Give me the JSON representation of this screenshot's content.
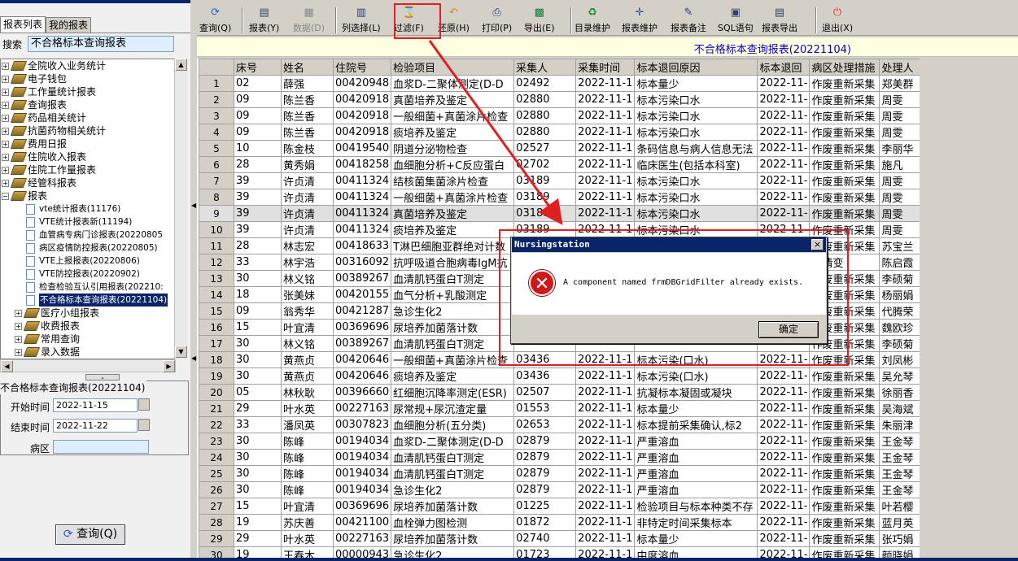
{
  "left": {
    "tabs": [
      "报表列表",
      "我的报表"
    ],
    "search_label": "搜索",
    "search_value": "不合格标本查询报表",
    "tree": [
      {
        "label": "全院收入业务统计",
        "type": "folder"
      },
      {
        "label": "电子钱包",
        "type": "folder"
      },
      {
        "label": "工作量统计报表",
        "type": "folder"
      },
      {
        "label": "查询报表",
        "type": "folder"
      },
      {
        "label": "药品相关统计",
        "type": "folder"
      },
      {
        "label": "抗菌药物相关统计",
        "type": "folder"
      },
      {
        "label": "费用日报",
        "type": "folder"
      },
      {
        "label": "住院收入报表",
        "type": "folder"
      },
      {
        "label": "住院工作量报表",
        "type": "folder"
      },
      {
        "label": "经管科报表",
        "type": "folder"
      },
      {
        "label": "报表",
        "type": "folder-open"
      },
      {
        "label": "vte统计报表(11176)",
        "type": "doc"
      },
      {
        "label": "VTE统计报表新(11194)",
        "type": "doc"
      },
      {
        "label": "血管病专病门诊报表(20220805",
        "type": "doc"
      },
      {
        "label": "病区疫情防控报表(20220805)",
        "type": "doc"
      },
      {
        "label": "VTE上报报表(20220806)",
        "type": "doc"
      },
      {
        "label": "VTE防控报表(20220902)",
        "type": "doc"
      },
      {
        "label": "检查检验互认引用报表(202210:",
        "type": "doc"
      },
      {
        "label": "不合格标本查询报表(20221104)",
        "type": "doc-selected"
      },
      {
        "label": "医疗小组报表",
        "type": "folder"
      },
      {
        "label": "收费报表",
        "type": "folder"
      },
      {
        "label": "常用查询",
        "type": "folder"
      },
      {
        "label": "录入数据",
        "type": "folder"
      }
    ],
    "group_title": "不合格标本查询报表(20221104)",
    "params": [
      {
        "label": "开始时间",
        "value": "2022-11-15"
      },
      {
        "label": "结束时间",
        "value": "2022-11-22"
      },
      {
        "label": "病区",
        "value": ""
      }
    ],
    "query_button": "查询(Q)"
  },
  "toolbar": [
    {
      "label": "查询(Q)",
      "icon": "refresh-icon",
      "disabled": false
    },
    {
      "label": "报表(Y)",
      "icon": "report-icon",
      "disabled": false
    },
    {
      "label": "数据(D)",
      "icon": "data-icon",
      "disabled": true
    },
    {
      "label": "列选择(L)",
      "icon": "columns-icon",
      "disabled": false
    },
    {
      "label": "过滤(F)",
      "icon": "hourglass-icon",
      "disabled": false
    },
    {
      "label": "还原(H)",
      "icon": "undo-icon",
      "disabled": false
    },
    {
      "label": "打印(P)",
      "icon": "printer-icon",
      "disabled": false
    },
    {
      "label": "导出(E)",
      "icon": "excel-icon",
      "disabled": false
    },
    {
      "label": "目录维护",
      "icon": "recycle-icon",
      "disabled": false
    },
    {
      "label": "报表维护",
      "icon": "move-icon",
      "disabled": false
    },
    {
      "label": "报表备注",
      "icon": "note-icon",
      "disabled": false
    },
    {
      "label": "SQL语句",
      "icon": "sql-icon",
      "disabled": false
    },
    {
      "label": "报表导出",
      "icon": "export-icon",
      "disabled": false
    },
    {
      "label": "退出(X)",
      "icon": "power-icon",
      "disabled": false
    }
  ],
  "report_title": "不合格标本查询报表(20221104)",
  "columns": [
    "床号",
    "姓名",
    "住院号",
    "检验项目",
    "采集人",
    "采集时间",
    "标本退回原因",
    "标本退回",
    "病区处理措施",
    "处理人"
  ],
  "rows": [
    [
      "1",
      "02",
      "薛强",
      "00420948",
      "血浆D-二聚体测定(D-D",
      "02492",
      "2022-11-1",
      "标本量少",
      "2022-11-",
      "作废重新采集",
      "郑美群"
    ],
    [
      "2",
      "09",
      "陈兰香",
      "00420918",
      "真菌培养及鉴定",
      "02880",
      "2022-11-1",
      "标本污染口水",
      "2022-11-",
      "作废重新采集",
      "周雯"
    ],
    [
      "3",
      "09",
      "陈兰香",
      "00420918",
      "一般细菌+真菌涂片检查",
      "02880",
      "2022-11-1",
      "标本污染口水",
      "2022-11-",
      "作废重新采集",
      "周雯"
    ],
    [
      "4",
      "09",
      "陈兰香",
      "00420918",
      "痰培养及鉴定",
      "02880",
      "2022-11-1",
      "标本污染口水",
      "2022-11-",
      "作废重新采集",
      "周雯"
    ],
    [
      "5",
      "10",
      "陈金枝",
      "00419540",
      "阴道分泌物检查",
      "02527",
      "2022-11-1",
      "条码信息与病人信息无法",
      "2022-11-",
      "作废重新采集",
      "李丽华"
    ],
    [
      "6",
      "28",
      "黄秀娟",
      "00418258",
      "血细胞分析+C反应蛋白",
      "02702",
      "2022-11-1",
      "临床医生(包括本科室)",
      "2022-11-",
      "作废重新采集",
      "施凡"
    ],
    [
      "7",
      "39",
      "许贞清",
      "00411324",
      "结核菌集菌涂片检查",
      "03189",
      "2022-11-1",
      "标本污染口水",
      "2022-11-",
      "作废重新采集",
      "周雯"
    ],
    [
      "8",
      "39",
      "许贞清",
      "00411324",
      "一般细菌+真菌涂片检查",
      "03189",
      "2022-11-1",
      "标本污染口水",
      "2022-11-",
      "作废重新采集",
      "周雯"
    ],
    [
      "9",
      "39",
      "许贞清",
      "00411324",
      "真菌培养及鉴定",
      "03189",
      "2022-11-1",
      "标本污染口水",
      "2022-11-",
      "作废重新采集",
      "周雯"
    ],
    [
      "10",
      "39",
      "许贞清",
      "00411324",
      "痰培养及鉴定",
      "03189",
      "2022-11-1",
      "标本污染口水",
      "2022-11-",
      "作废重新采集",
      "周雯"
    ],
    [
      "11",
      "28",
      "林志宏",
      "00418633",
      "T淋巴细胞亚群绝对计数",
      "",
      "",
      "",
      "",
      "作废重新采集",
      "苏宝兰"
    ],
    [
      "12",
      "33",
      "林宇浩",
      "00316092",
      "抗呼吸道合胞病毒IgM抗",
      "",
      "",
      "",
      "",
      "病情变",
      "陈启霞"
    ],
    [
      "13",
      "30",
      "林义铭",
      "00389267",
      "血清肌钙蛋白T测定",
      "",
      "",
      "",
      "",
      "作废重新采集",
      "李硕菊"
    ],
    [
      "14",
      "18",
      "张美妹",
      "00420155",
      "血气分析+乳酸测定",
      "",
      "",
      "",
      "",
      "作废重新采集",
      "杨丽娟"
    ],
    [
      "15",
      "09",
      "翁秀华",
      "00421287",
      "急诊生化2",
      "",
      "",
      "",
      "",
      "作废重新采集",
      "代腾荣"
    ],
    [
      "16",
      "15",
      "叶宜清",
      "00369696",
      "尿培养加菌落计数",
      "",
      "",
      "",
      "",
      "作废重新采集",
      "魏欧珍"
    ],
    [
      "17",
      "30",
      "林义铭",
      "00389267",
      "血清肌钙蛋白T测定",
      "",
      "",
      "",
      "",
      "作废重新采集",
      "李硕菊"
    ],
    [
      "18",
      "30",
      "黄燕贞",
      "00420646",
      "一般细菌+真菌涂片检查",
      "03436",
      "2022-11-1",
      "标本污染(口水)",
      "2022-11-",
      "作废重新采集",
      "刘凤彬"
    ],
    [
      "19",
      "30",
      "黄燕贞",
      "00420646",
      "痰培养及鉴定",
      "03436",
      "2022-11-1",
      "标本污染(口水)",
      "2022-11-",
      "作废重新采集",
      "吴允琴"
    ],
    [
      "20",
      "05",
      "林秋耿",
      "00396660",
      "红细胞沉降率测定(ESR)",
      "02507",
      "2022-11-1",
      "抗凝标本凝固或凝块",
      "2022-11-",
      "作废重新采集",
      "徐丽香"
    ],
    [
      "21",
      "29",
      "叶水英",
      "00227163",
      "尿常规+尿沉渣定量",
      "01553",
      "2022-11-1",
      "标本量少",
      "2022-11-",
      "作废重新采集",
      "吴海斌"
    ],
    [
      "22",
      "33",
      "潘凤英",
      "00307823",
      "血细胞分析(五分类)",
      "02653",
      "2022-11-1",
      "标本提前采集确认,标2",
      "2022-11-",
      "作废重新采集",
      "朱丽津"
    ],
    [
      "23",
      "30",
      "陈峰",
      "00194034",
      "血浆D-二聚体测定(D-D",
      "02879",
      "2022-11-1",
      "严重溶血",
      "2022-11-",
      "作废重新采集",
      "王金琴"
    ],
    [
      "24",
      "30",
      "陈峰",
      "00194034",
      "血清肌钙蛋白T测定",
      "02879",
      "2022-11-1",
      "严重溶血",
      "2022-11-",
      "作废重新采集",
      "王金琴"
    ],
    [
      "25",
      "30",
      "陈峰",
      "00194034",
      "血清肌钙蛋白T测定",
      "02879",
      "2022-11-1",
      "严重溶血",
      "2022-11-",
      "作废重新采集",
      "王金琴"
    ],
    [
      "26",
      "30",
      "陈峰",
      "00194034",
      "急诊生化2",
      "02879",
      "2022-11-1",
      "严重溶血",
      "2022-11-",
      "作废重新采集",
      "王金琴"
    ],
    [
      "27",
      "15",
      "叶宜清",
      "00369696",
      "尿培养加菌落计数",
      "01225",
      "2022-11-1",
      "检验项目与标本种类不存",
      "2022-11-",
      "作废重新采集",
      "叶若樱"
    ],
    [
      "28",
      "19",
      "苏庆善",
      "00421100",
      "血栓弹力图检测",
      "01872",
      "2022-11-1",
      "非特定时间采集标本",
      "2022-11-",
      "作废重新采集",
      "蓝月英"
    ],
    [
      "29",
      "29",
      "叶水英",
      "00227163",
      "尿培养加菌落计数",
      "02740",
      "2022-11-1",
      "标本量少",
      "2022-11-",
      "作废重新采集",
      "张巧娟"
    ],
    [
      "30",
      "19",
      "王春木",
      "00000943",
      "急诊生化2",
      "01723",
      "2022-11-1",
      "中度溶血",
      "2022-11-",
      "作废重新采集",
      "颜晓娟"
    ]
  ],
  "highlighted_row": 9,
  "dialog": {
    "title": "Nursingstation",
    "message": "A component named frmDBGridFilter already exists.",
    "ok_label": "确定",
    "close_label": "×"
  },
  "colors": {
    "annotation": "#e02020",
    "selection": "#0a246a",
    "title_text": "#0000cc"
  }
}
